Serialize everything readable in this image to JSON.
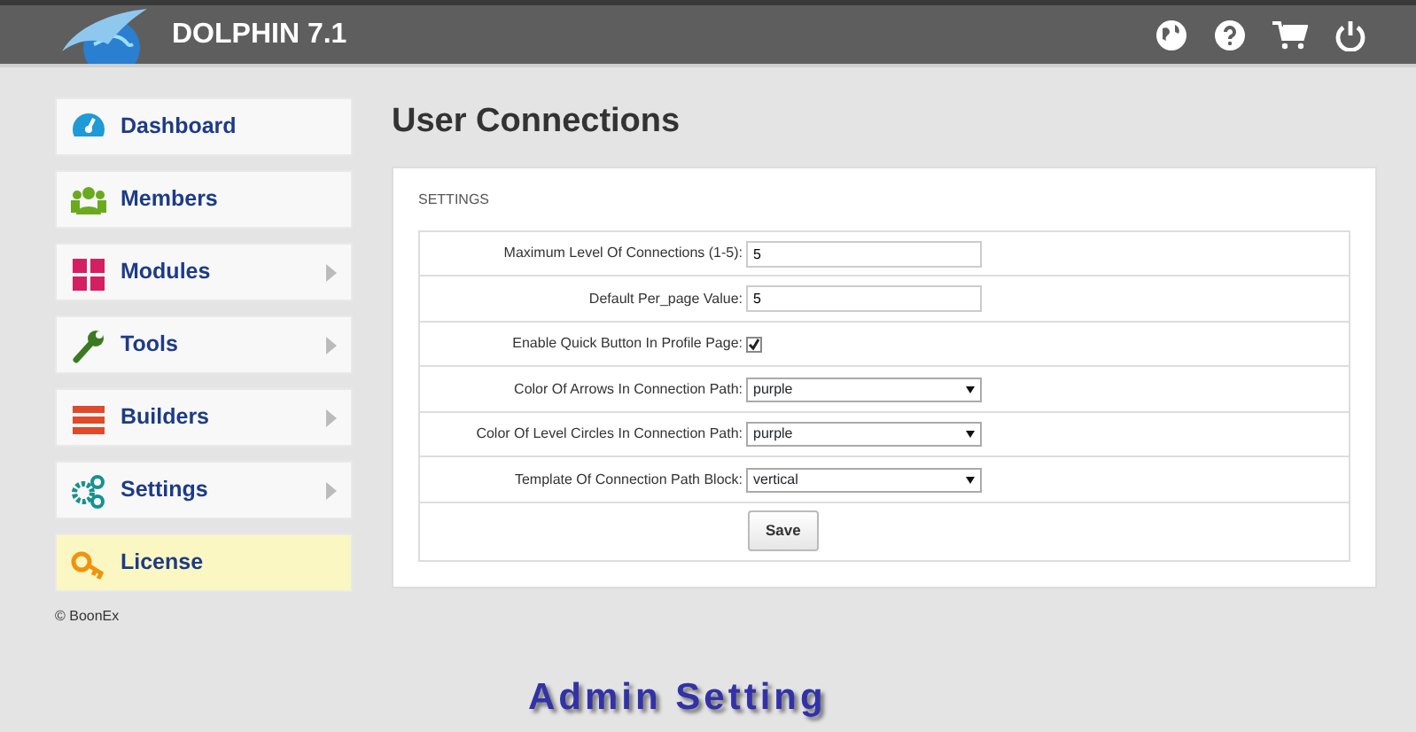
{
  "header": {
    "title": "DOLPHIN 7.1"
  },
  "sidebar": {
    "items": [
      {
        "label": "Dashboard",
        "has_submenu": false,
        "highlighted": false
      },
      {
        "label": "Members",
        "has_submenu": false,
        "highlighted": false
      },
      {
        "label": "Modules",
        "has_submenu": true,
        "highlighted": false
      },
      {
        "label": "Tools",
        "has_submenu": true,
        "highlighted": false
      },
      {
        "label": "Builders",
        "has_submenu": true,
        "highlighted": false
      },
      {
        "label": "Settings",
        "has_submenu": true,
        "highlighted": false
      },
      {
        "label": "License",
        "has_submenu": false,
        "highlighted": true
      }
    ],
    "copyright": "© BoonEx"
  },
  "page_title": "User Connections",
  "panel": {
    "heading": "SETTINGS",
    "fields": [
      {
        "kind": "text",
        "label": "Maximum Level Of Connections (1-5):",
        "value": "5"
      },
      {
        "kind": "text",
        "label": "Default Per_page Value:",
        "value": "5"
      },
      {
        "kind": "checkbox",
        "label": "Enable Quick Button In Profile Page:",
        "checked": true
      },
      {
        "kind": "select",
        "label": "Color Of Arrows In Connection Path:",
        "value": "purple"
      },
      {
        "kind": "select",
        "label": "Color Of Level Circles In Connection Path:",
        "value": "purple"
      },
      {
        "kind": "select",
        "label": "Template Of Connection Path Block:",
        "value": "vertical"
      }
    ],
    "save_button": "Save"
  },
  "caption": "Admin Setting"
}
